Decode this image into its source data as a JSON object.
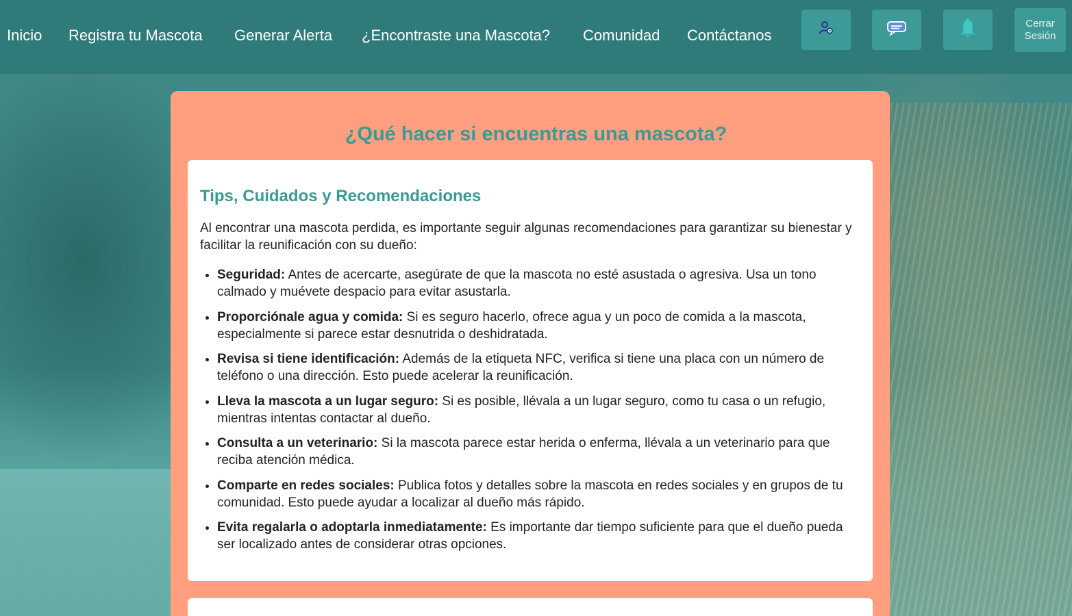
{
  "nav": {
    "links": [
      "Inicio",
      "Registra tu Mascota",
      "Generar Alerta",
      "¿Encontraste una Mascota?",
      "Comunidad",
      "Contáctanos"
    ],
    "buttons": {
      "profile_icon": "user-settings-icon",
      "chat_icon": "chat-icon",
      "bell_icon": "bell-icon",
      "logout_line1": "Cerrar",
      "logout_line2": "Sesión"
    }
  },
  "main": {
    "title": "¿Qué hacer si encuentras una mascota?",
    "section": {
      "title": "Tips, Cuidados y Recomendaciones",
      "intro": "Al encontrar una mascota perdida, es importante seguir algunas recomendaciones para garantizar su bienestar y facilitar la reunificación con su dueño:",
      "tips": [
        {
          "label": "Seguridad:",
          "text": " Antes de acercarte, asegúrate de que la mascota no esté asustada o agresiva. Usa un tono calmado y muévete despacio para evitar asustarla."
        },
        {
          "label": "Proporciónale agua y comida:",
          "text": " Si es seguro hacerlo, ofrece agua y un poco de comida a la mascota, especialmente si parece estar desnutrida o deshidratada."
        },
        {
          "label": "Revisa si tiene identificación:",
          "text": " Además de la etiqueta NFC, verifica si tiene una placa con un número de teléfono o una dirección. Esto puede acelerar la reunificación."
        },
        {
          "label": "Lleva la mascota a un lugar seguro:",
          "text": " Si es posible, llévala a un lugar seguro, como tu casa o un refugio, mientras intentas contactar al dueño."
        },
        {
          "label": "Consulta a un veterinario:",
          "text": " Si la mascota parece estar herida o enferma, llévala a un veterinario para que reciba atención médica."
        },
        {
          "label": "Comparte en redes sociales:",
          "text": " Publica fotos y detalles sobre la mascota en redes sociales y en grupos de tu comunidad. Esto puede ayudar a localizar al dueño más rápido."
        },
        {
          "label": "Evita regalarla o adoptarla inmediatamente:",
          "text": " Es importante dar tiempo suficiente para que el dueño pueda ser localizado antes de considerar otras opciones."
        }
      ]
    }
  },
  "colors": {
    "navbar": "#2e7b7a",
    "panel": "#ff9f7f",
    "accent_text": "#3a9a96"
  }
}
